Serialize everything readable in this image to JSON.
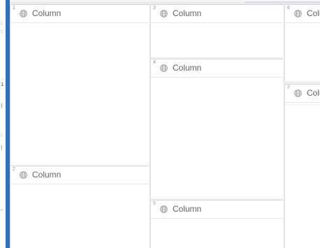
{
  "left_strip": {
    "marks": [
      ":",
      ":",
      "1",
      "|",
      ":",
      "|",
      "-"
    ]
  },
  "panels": [
    {
      "number": "1",
      "title": "Column",
      "icon": "globe-icon"
    },
    {
      "number": "2",
      "title": "Column",
      "icon": "globe-icon"
    },
    {
      "number": "3",
      "title": "Column",
      "icon": "globe-icon"
    },
    {
      "number": "4",
      "title": "Column",
      "icon": "globe-icon"
    },
    {
      "number": "5",
      "title": "Column",
      "icon": "globe-icon"
    },
    {
      "number": "6",
      "title": "Column",
      "icon": "globe-icon"
    },
    {
      "number": "7",
      "title": "Column",
      "icon": "globe-icon"
    }
  ],
  "colors": {
    "accent": "#2b71c2",
    "panel_background": "#ffffff",
    "gap_background": "#eef1f3",
    "header_text": "#5d6670"
  }
}
